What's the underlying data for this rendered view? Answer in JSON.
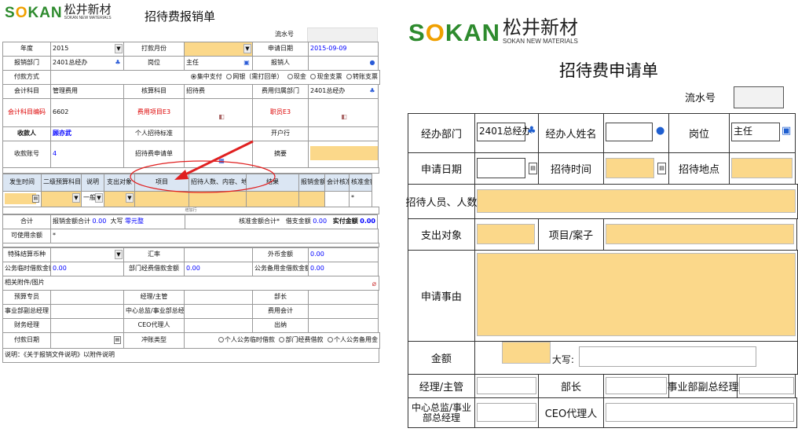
{
  "logo": {
    "brand": "SOKAN",
    "cn": "松井新材",
    "en": "SOKAN NEW MATERIALS"
  },
  "left": {
    "title": "招待费报销单",
    "serial_label": "流水号",
    "year_label": "年度",
    "year_value": "2015",
    "pay_month_label": "打款月份",
    "apply_date_label": "申请日期",
    "apply_date_value": "2015-09-09",
    "dept_label": "报销部门",
    "dept_value": "2401总经办",
    "position_label": "岗位",
    "position_value": "主任",
    "reimburser_label": "报销人",
    "pay_method_label": "付款方式",
    "pay_options": [
      "集中支付",
      "网银（需打回单）",
      "现金",
      "现金支票",
      "转账支票"
    ],
    "account_subject_label": "会计科目",
    "account_subject_value": "管理费用",
    "check_subject_label": "核算科目",
    "check_subject_value": "招待费",
    "cost_dept_label": "费用归属部门",
    "cost_dept_value": "2401总经办",
    "subject_code_label": "会计科目编码",
    "subject_code_value": "6602",
    "cost_item_label": "费用项目E3",
    "staff_label": "职员E3",
    "payee_label": "收款人",
    "payee_value": "顾亦武",
    "std_label": "个人招待标准",
    "bank_label": "开户行",
    "account_no_label": "收款账号",
    "account_no_value": "4",
    "apply_form_label": "招待费申请单",
    "summary_label": "摘要",
    "detail_headers": [
      "发生时间",
      "二级预算科目",
      "说明",
      "支出对象",
      "项目",
      "招待人数、内容、地点",
      "结果",
      "报销金额",
      "会计核准",
      "核准金额"
    ],
    "detail_row": {
      "desc": "一般",
      "mark": "*"
    },
    "add_row_label": "增加行",
    "total_label": "合计",
    "total_amt_label": "报销金额合计",
    "total_amt_value": "0.00",
    "caps_label": "大写",
    "caps_value": "零元整",
    "approved_total_label": "核准金额合计*",
    "borrow_label": "借支金额",
    "borrow_value": "0.00",
    "actual_label": "实付金额",
    "actual_value": "0.00",
    "available_label": "可使用余额",
    "available_value": "*",
    "special_currency_label": "特殊结算币种",
    "rate_label": "汇率",
    "foreign_amt_label": "外币金额",
    "foreign_amt_value": "0.00",
    "temp_loan_label": "公务临时借款金额",
    "temp_loan_value": "0.00",
    "dept_loan_label": "部门经费借款金额",
    "dept_loan_value": "0.00",
    "reserve_loan_label": "公务备用金借款金额",
    "reserve_loan_value": "0.00",
    "attach_label": "相关附件/图片",
    "budget_label": "预算专员",
    "manager_label": "经理/主管",
    "minister_label": "部长",
    "deputy_gm_label": "事业部副总经理",
    "center_label": "中心总监/事业部总经理",
    "accountant_label": "费用会计",
    "finance_label": "财务经理",
    "ceo_label": "CEO代理人",
    "cashier_label": "出纳",
    "pay_date_label": "付款日期",
    "offset_label": "冲账类型",
    "offset_options": [
      "个人公务临时借款",
      "部门经费借款",
      "个人公务备用金"
    ],
    "note": "说明：《关于报销文件说明》以附件说明"
  },
  "right": {
    "title": "招待费申请单",
    "serial_label": "流水号",
    "dept_label": "经办部门",
    "dept_value": "2401总经办",
    "handler_label": "经办人姓名",
    "position_label": "岗位",
    "position_value": "主任",
    "apply_date_label": "申请日期",
    "time_label": "招待时间",
    "place_label": "招待地点",
    "people_label": "招待人员、人数",
    "target_label": "支出对象",
    "project_label": "项目/案子",
    "reason_label": "申请事由",
    "amount_label": "金额",
    "caps_label": "大写:",
    "manager_label": "经理/主管",
    "minister_label": "部长",
    "deputy_gm_label": "事业部副总经理",
    "center_label": "中心总监/事业部总经理",
    "ceo_label": "CEO代理人"
  },
  "colors": {
    "highlight": "#fbd88a",
    "brand_green": "#2e8b2e",
    "annotation_red": "#e02020"
  }
}
